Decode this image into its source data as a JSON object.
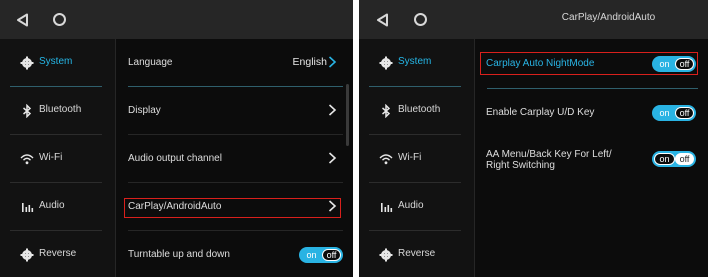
{
  "left_screen": {
    "sidebar": [
      {
        "label": "System",
        "icon": "gear-icon",
        "active": true
      },
      {
        "label": "Bluetooth",
        "icon": "bluetooth-icon"
      },
      {
        "label": "Wi-Fi",
        "icon": "wifi-icon"
      },
      {
        "label": "Audio",
        "icon": "audio-bars-icon"
      },
      {
        "label": "Reverse",
        "icon": "gear-icon"
      }
    ],
    "rows": [
      {
        "label": "Language",
        "value": "English"
      },
      {
        "label": "Display"
      },
      {
        "label": "Audio output channel"
      },
      {
        "label": "CarPlay/AndroidAuto"
      },
      {
        "label": "Turntable up and down",
        "toggle_on": "on",
        "toggle_off": "off"
      }
    ]
  },
  "right_screen": {
    "title": "CarPlay/AndroidAuto",
    "sidebar": [
      {
        "label": "System",
        "icon": "gear-icon",
        "active": true
      },
      {
        "label": "Bluetooth",
        "icon": "bluetooth-icon"
      },
      {
        "label": "Wi-Fi",
        "icon": "wifi-icon"
      },
      {
        "label": "Audio",
        "icon": "audio-bars-icon"
      },
      {
        "label": "Reverse",
        "icon": "gear-icon"
      }
    ],
    "rows": [
      {
        "label": "Carplay Auto NightMode",
        "toggle_on": "on",
        "toggle_off": "off"
      },
      {
        "label": "Enable Carplay U/D Key",
        "toggle_on": "on",
        "toggle_off": "off"
      },
      {
        "label": "AA Menu/Back Key For Left/ Right Switching",
        "toggle_on": "on",
        "toggle_off": "off"
      }
    ]
  },
  "colors": {
    "accent_blue": "#29b3e3",
    "highlight_red": "#d9201c",
    "background": "#0c0c0c",
    "topbar": "#262626"
  }
}
